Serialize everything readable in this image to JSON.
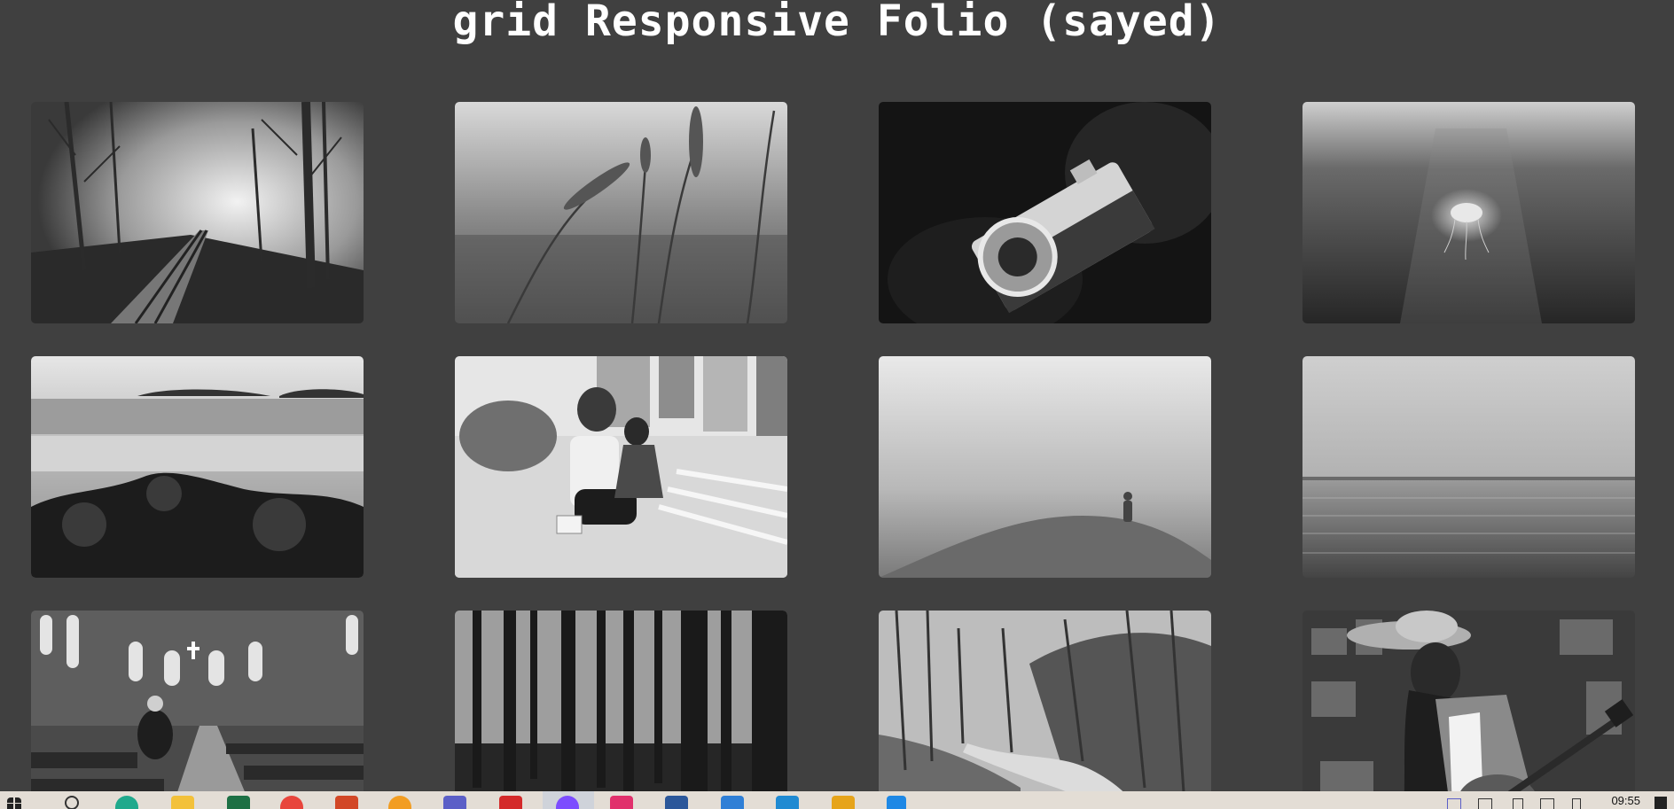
{
  "page": {
    "title": "grid Responsive Folio (sayed)"
  },
  "gallery": {
    "items": [
      {
        "subject": "misty forest railway"
      },
      {
        "subject": "wheat grass closeup"
      },
      {
        "subject": "hands holding camera"
      },
      {
        "subject": "jellyfish underwater"
      },
      {
        "subject": "rocky shore and islands"
      },
      {
        "subject": "mother and child on street"
      },
      {
        "subject": "person walking in fog"
      },
      {
        "subject": "calm sea horizon"
      },
      {
        "subject": "church interior"
      },
      {
        "subject": "pine forest with shadows"
      },
      {
        "subject": "winding road through woods"
      },
      {
        "subject": "woman playing guitar in record shop"
      }
    ]
  },
  "taskbar": {
    "time": "09:55",
    "icons": [
      "start-icon",
      "search-icon",
      "edge-icon",
      "file-explorer-icon",
      "excel-icon",
      "chrome-icon",
      "powerpoint-icon",
      "firefox-icon",
      "teams-icon",
      "pdf-icon",
      "app-icon",
      "instagram-icon",
      "word-icon",
      "mail-icon",
      "vscode-icon",
      "paint-icon",
      "info-icon"
    ],
    "colors": {
      "background": "#e3ddd5",
      "edge": "#1fa98c",
      "explorer": "#f3c13a",
      "excel": "#1d7044",
      "chrome": "#e8453c",
      "powerpoint": "#d24726",
      "firefox": "#f29d22",
      "teams": "#5b5fc7",
      "pdf": "#d42a2a",
      "active": "#7c4dff",
      "instagram": "#e1306c",
      "word": "#2b579a",
      "mail": "#2f7fd6",
      "vscode": "#1f8ad2",
      "paint": "#e6a41b",
      "info": "#1e88e5"
    }
  },
  "colors": {
    "page_background": "#404040",
    "title": "#ffffff"
  }
}
